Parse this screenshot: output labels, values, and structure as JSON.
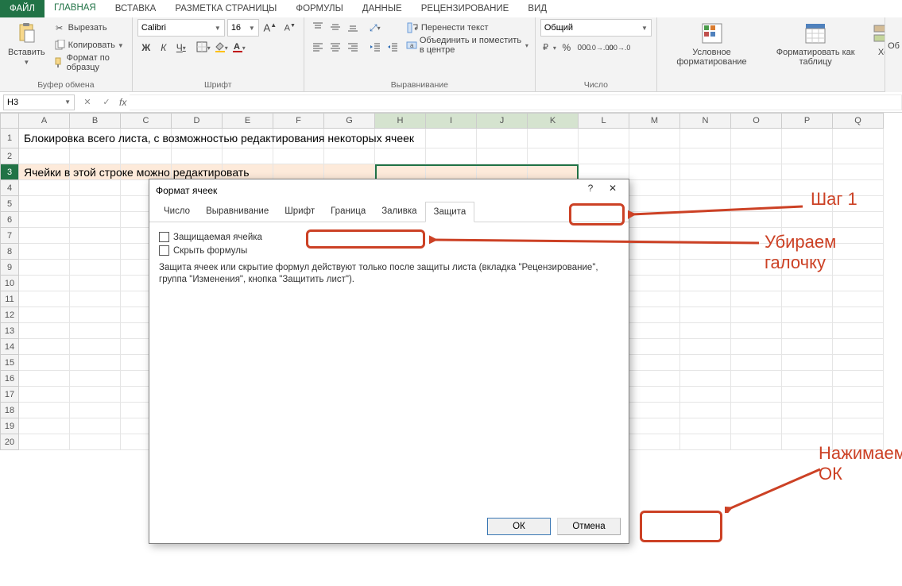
{
  "tabs": {
    "file": "ФАЙЛ",
    "items": [
      "ГЛАВНАЯ",
      "ВСТАВКА",
      "РАЗМЕТКА СТРАНИЦЫ",
      "ФОРМУЛЫ",
      "ДАННЫЕ",
      "РЕЦЕНЗИРОВАНИЕ",
      "ВИД"
    ],
    "active_index": 0
  },
  "ribbon": {
    "clipboard": {
      "paste": "Вставить",
      "cut": "Вырезать",
      "copy": "Копировать",
      "format_painter": "Формат по образцу",
      "label": "Буфер обмена"
    },
    "font": {
      "name": "Calibri",
      "size": "16",
      "bold": "Ж",
      "italic": "К",
      "underline": "Ч",
      "label": "Шрифт"
    },
    "alignment": {
      "wrap": "Перенести текст",
      "merge": "Объединить и поместить в центре",
      "label": "Выравнивание"
    },
    "number": {
      "format": "Общий",
      "label": "Число"
    },
    "styles": {
      "cond": "Условное\nформатирование",
      "table": "Форматировать\nкак таблицу",
      "ho": "Хо"
    },
    "ob": "Об"
  },
  "formula_bar": {
    "name_box": "H3",
    "cancel": "✕",
    "enter": "✓",
    "fx": "fx",
    "value": ""
  },
  "columns": [
    "A",
    "B",
    "C",
    "D",
    "E",
    "F",
    "G",
    "H",
    "I",
    "J",
    "K",
    "L",
    "M",
    "N",
    "O",
    "P",
    "Q"
  ],
  "rows": 20,
  "cells": {
    "r1": "Блокировка всего листа, с возможностью редактирования некоторых ячеек",
    "r3": "Ячейки в этой строке можно редактировать"
  },
  "selection": {
    "name_ref": "H3",
    "col_start": 7,
    "col_end": 10,
    "row": 3
  },
  "dialog": {
    "title": "Формат ячеек",
    "help_icon": "?",
    "close_icon": "✕",
    "tabs": [
      "Число",
      "Выравнивание",
      "Шрифт",
      "Граница",
      "Заливка",
      "Защита"
    ],
    "active_tab": 5,
    "protect_cell": "Защищаемая ячейка",
    "hide_formulas": "Скрыть формулы",
    "help_text": "Защита ячеек или скрытие формул действуют только после защиты листа (вкладка \"Рецензирование\", группа \"Изменения\", кнопка \"Защитить лист\").",
    "ok": "ОК",
    "cancel": "Отмена"
  },
  "annotations": {
    "step1": "Шаг 1",
    "remove_check": "Убираем галочку",
    "press_ok": "Нажимаем ОК"
  }
}
